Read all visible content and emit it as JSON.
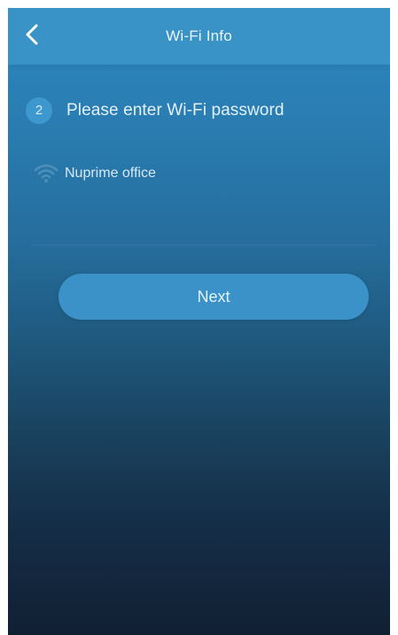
{
  "header": {
    "title": "Wi-Fi Info",
    "back_icon": "chevron-left-icon"
  },
  "step": {
    "number": "2",
    "instruction": "Please enter Wi-Fi password"
  },
  "wifi": {
    "ssid": "Nuprime office",
    "icon": "wifi-icon",
    "password_value": ""
  },
  "actions": {
    "next_label": "Next"
  },
  "colors": {
    "header_bg": "#3a93c6",
    "accent": "#3d98cf",
    "button_bg": "#3a92c8",
    "background_top": "#2c88bf",
    "background_bottom": "#111f33"
  }
}
